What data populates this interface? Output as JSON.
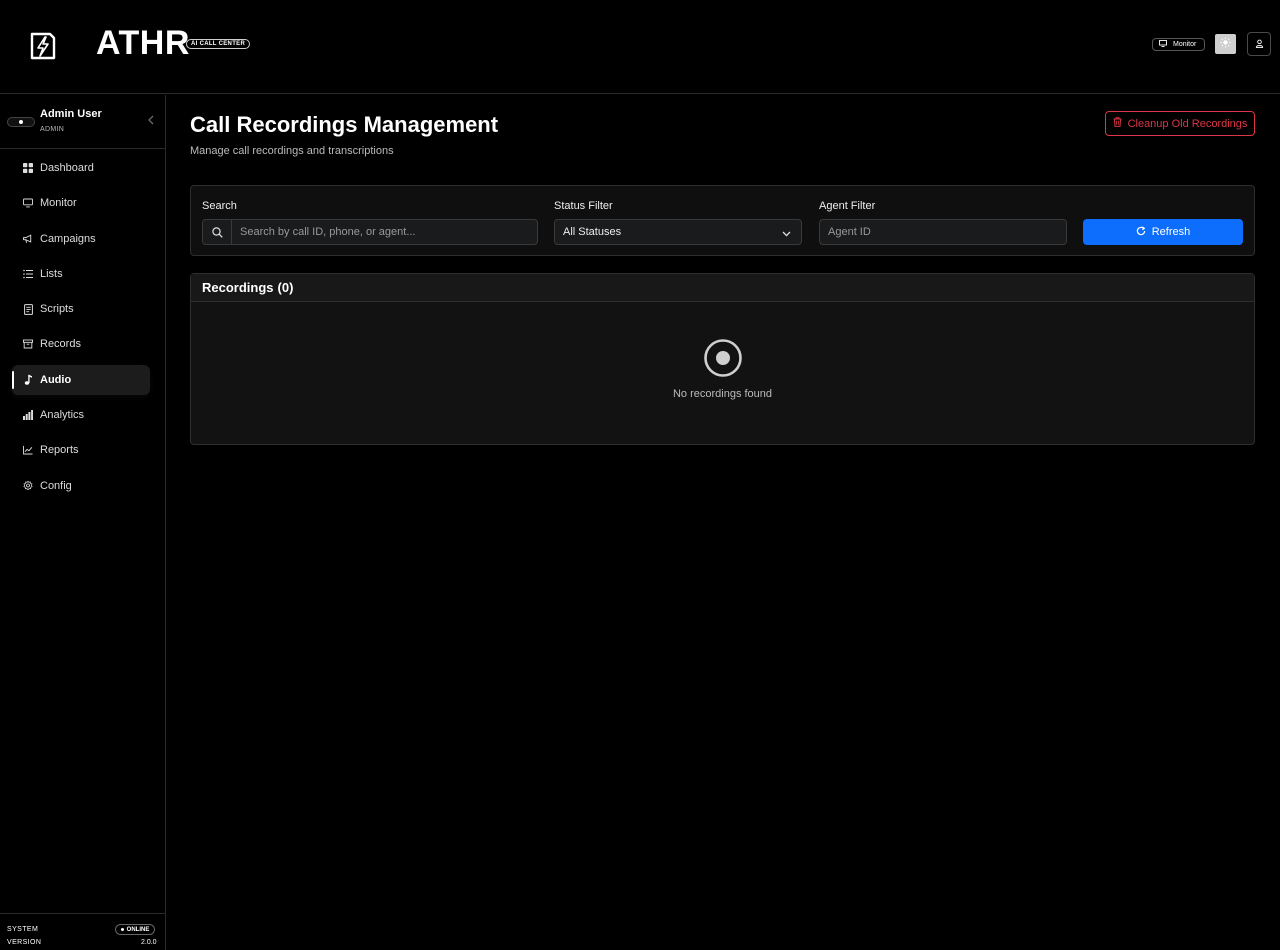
{
  "header": {
    "brand": "ATHR",
    "tag": "AI CALL CENTER",
    "monitor_label": "Monitor",
    "icons": [
      "logo-icon",
      "monitor-icon",
      "sun-icon",
      "user-icon"
    ]
  },
  "sidebar": {
    "user_name": "Admin User",
    "user_role": "ADMIN",
    "items": [
      {
        "label": "Dashboard",
        "icon": "dashboard-icon"
      },
      {
        "label": "Monitor",
        "icon": "monitor-icon"
      },
      {
        "label": "Campaigns",
        "icon": "megaphone-icon"
      },
      {
        "label": "Lists",
        "icon": "list-icon"
      },
      {
        "label": "Scripts",
        "icon": "script-icon"
      },
      {
        "label": "Records",
        "icon": "archive-icon"
      },
      {
        "label": "Audio",
        "icon": "music-note-icon",
        "active": true
      },
      {
        "label": "Analytics",
        "icon": "bar-chart-icon"
      },
      {
        "label": "Reports",
        "icon": "line-chart-icon"
      },
      {
        "label": "Config",
        "icon": "gear-icon"
      }
    ],
    "system_label": "SYSTEM",
    "system_status": "ONLINE",
    "version_label": "VERSION",
    "version_value": "2.0.0"
  },
  "main": {
    "title": "Call Recordings Management",
    "subtitle": "Manage call recordings and transcriptions",
    "cleanup_label": "Cleanup Old Recordings",
    "filters": {
      "search_label": "Search",
      "search_placeholder": "Search by call ID, phone, or agent...",
      "status_label": "Status Filter",
      "status_value": "All Statuses",
      "agent_label": "Agent Filter",
      "agent_placeholder": "Agent ID",
      "refresh_label": "Refresh"
    },
    "recordings": {
      "title": "Recordings",
      "count": "(0)",
      "empty_text": "No recordings found"
    }
  },
  "colors": {
    "accent": "#0d6efd",
    "danger": "#dc3545",
    "background": "#000000"
  }
}
